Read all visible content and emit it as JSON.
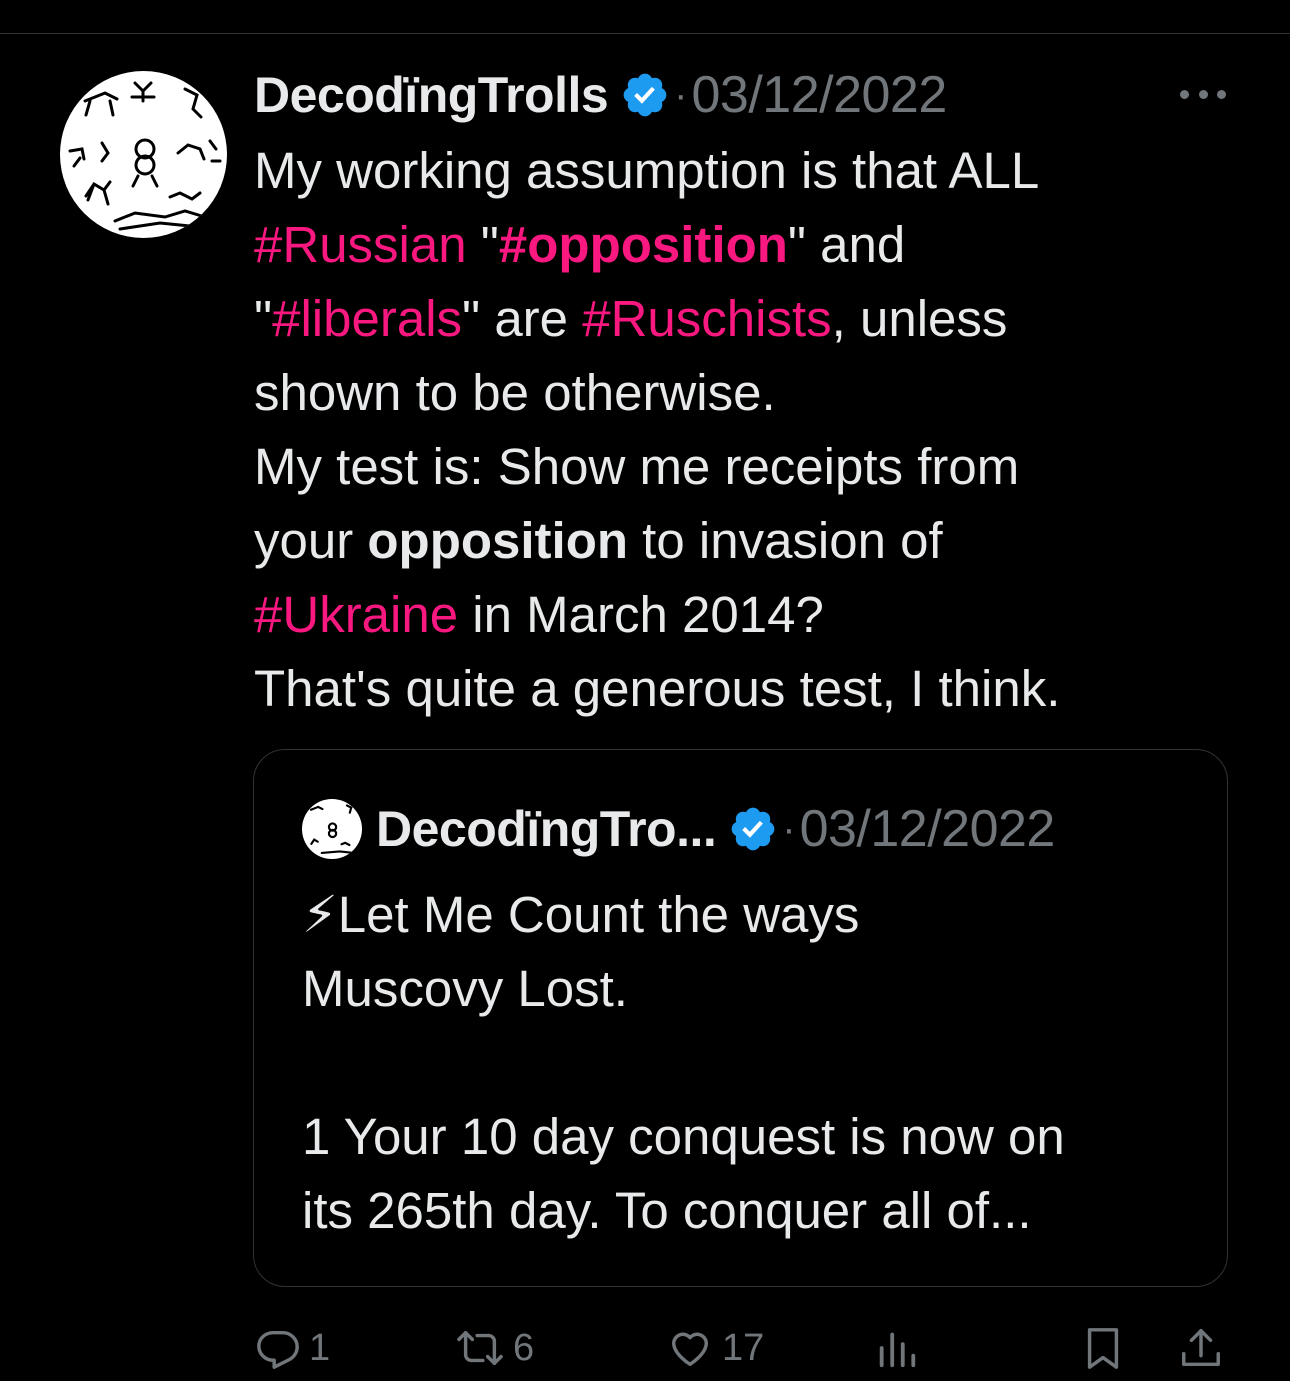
{
  "tweet": {
    "author": "DecodïngTrolls",
    "separator": "·",
    "date": "03/12/2022",
    "lines": [
      [
        {
          "t": "My working assumption is that ALL"
        }
      ],
      [
        {
          "t": "#Russian",
          "s": "tag"
        },
        {
          "t": " \""
        },
        {
          "t": "#opposition",
          "s": "tagbold"
        },
        {
          "t": "\" and"
        }
      ],
      [
        {
          "t": "\""
        },
        {
          "t": "#liberals",
          "s": "tag"
        },
        {
          "t": "\" are "
        },
        {
          "t": "#Ruschists",
          "s": "tag"
        },
        {
          "t": ", unless"
        }
      ],
      [
        {
          "t": "shown to be otherwise."
        }
      ],
      [
        {
          "t": "My test is: Show me receipts from"
        }
      ],
      [
        {
          "t": "your "
        },
        {
          "t": "opposition",
          "s": "bold"
        },
        {
          "t": " to invasion of"
        }
      ],
      [
        {
          "t": "#Ukraine",
          "s": "tag"
        },
        {
          "t": " in March 2014?"
        }
      ],
      [
        {
          "t": "That's quite a generous test, I think."
        }
      ]
    ]
  },
  "quote": {
    "author": "DecodïngTro...",
    "separator": "·",
    "date": "03/12/2022",
    "lines": [
      "⚡Let Me Count the ways",
      "Muscovy Lost.",
      "",
      "1 Your 10 day conquest is now on",
      "its 265th day. To conquer all of..."
    ]
  },
  "actions": {
    "replies": "1",
    "retweets": "6",
    "likes": "17"
  },
  "colors": {
    "background": "#000000",
    "text": "#e7e9ea",
    "muted": "#71767b",
    "hashtag": "#f91880",
    "verified": "#1d9bf0",
    "border": "#2f3336"
  }
}
